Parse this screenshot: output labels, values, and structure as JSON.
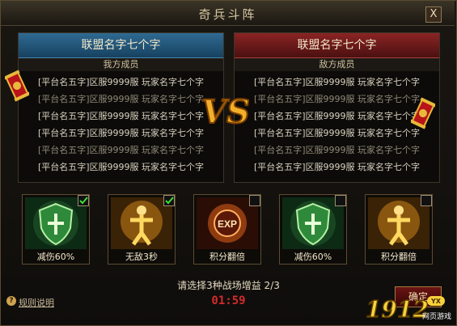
{
  "window": {
    "title": "奇兵斗阵",
    "close_label": "X"
  },
  "left_panel": {
    "alliance_name": "联盟名字七个字",
    "subtitle": "我方成员",
    "members": [
      "[平台名五字]区服9999服 玩家名字七个字",
      "[平台名五字]区服9999服 玩家名字七个字",
      "[平台名五字]区服9999服 玩家名字七个字",
      "[平台名五字]区服9999服 玩家名字七个字",
      "[平台名五字]区服9999服 玩家名字七个字",
      "[平台名五字]区服9999服 玩家名字七个字"
    ]
  },
  "right_panel": {
    "alliance_name": "联盟名字七个字",
    "subtitle": "敌方成员",
    "members": [
      "[平台名五字]区服9999服 玩家名字七个字",
      "[平台名五字]区服9999服 玩家名字七个字",
      "[平台名五字]区服9999服 玩家名字七个字",
      "[平台名五字]区服9999服 玩家名字七个字",
      "[平台名五字]区服9999服 玩家名字七个字",
      "[平台名五字]区服9999服 玩家名字七个字"
    ]
  },
  "versus_label": "VS",
  "buffs": [
    {
      "label": "减伤60%",
      "icon": "shield-icon",
      "checked": true
    },
    {
      "label": "无敌3秒",
      "icon": "golden-figure-icon",
      "checked": true
    },
    {
      "label": "积分翻倍",
      "icon": "exp-icon",
      "checked": false
    },
    {
      "label": "减伤60%",
      "icon": "shield-icon",
      "checked": false
    },
    {
      "label": "积分翻倍",
      "icon": "golden-figure-icon",
      "checked": false
    }
  ],
  "prompt": "请选择3种战场增益 2/3",
  "timer": "01:59",
  "rules_label": "规则说明",
  "confirm_button": "确定",
  "watermark": {
    "number": "1912",
    "badge": "YX",
    "site": "网页游戏"
  },
  "colors": {
    "ally": "#2f6a92",
    "enemy": "#8b2424",
    "timer": "#d22b2b",
    "gold": "#e8b93a"
  }
}
